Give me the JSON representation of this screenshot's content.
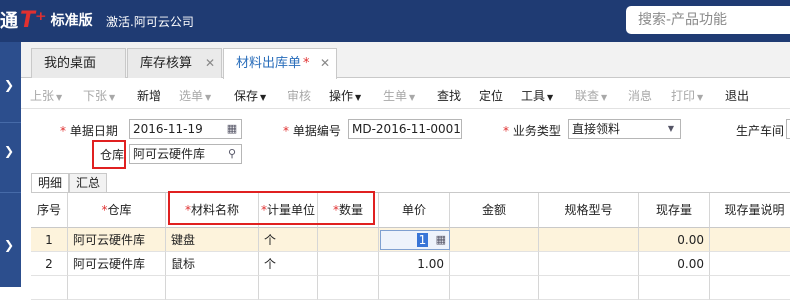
{
  "app": {
    "glyph": "通",
    "brand": "T⁺",
    "edition": "标准版",
    "activation": "激活.阿可云公司",
    "search_placeholder": "搜索-产品功能"
  },
  "tabs": [
    {
      "label": "我的桌面",
      "closable": false,
      "dirty": ""
    },
    {
      "label": "库存核算",
      "closable": true,
      "dirty": ""
    },
    {
      "label": "材料出库单",
      "closable": true,
      "dirty": "*"
    }
  ],
  "toolbar": [
    {
      "label": "上张",
      "dropdown": true,
      "enabled": false
    },
    {
      "label": "下张",
      "dropdown": true,
      "enabled": false
    },
    {
      "label": "新增",
      "dropdown": false,
      "enabled": true
    },
    {
      "label": "选单",
      "dropdown": true,
      "enabled": false
    },
    {
      "label": "保存",
      "dropdown": true,
      "enabled": true
    },
    {
      "label": "审核",
      "dropdown": false,
      "enabled": false
    },
    {
      "label": "操作",
      "dropdown": true,
      "enabled": true
    },
    {
      "label": "生单",
      "dropdown": true,
      "enabled": false
    },
    {
      "label": "查找",
      "dropdown": false,
      "enabled": true
    },
    {
      "label": "定位",
      "dropdown": false,
      "enabled": true
    },
    {
      "label": "工具",
      "dropdown": true,
      "enabled": true
    },
    {
      "label": "联查",
      "dropdown": true,
      "enabled": false
    },
    {
      "label": "消息",
      "dropdown": false,
      "enabled": false
    },
    {
      "label": "打印",
      "dropdown": true,
      "enabled": false
    },
    {
      "label": "退出",
      "dropdown": false,
      "enabled": true
    }
  ],
  "form": {
    "required_mark": "*",
    "date_label": "单据日期",
    "date_value": "2016-11-19",
    "code_label": "单据编号",
    "code_value": "MD-2016-11-0001",
    "biztype_label": "业务类型",
    "biztype_value": "直接领料",
    "workshop_label": "生产车间",
    "warehouse_label": "仓库",
    "warehouse_value": "阿可云硬件库"
  },
  "subtabs": [
    "明细",
    "汇总"
  ],
  "grid": {
    "columns": [
      {
        "label": "序号",
        "required": false
      },
      {
        "label": "仓库",
        "required": true
      },
      {
        "label": "材料名称",
        "required": true
      },
      {
        "label": "计量单位",
        "required": true
      },
      {
        "label": "数量",
        "required": true
      },
      {
        "label": "单价",
        "required": false
      },
      {
        "label": "金额",
        "required": false
      },
      {
        "label": "规格型号",
        "required": false
      },
      {
        "label": "现存量",
        "required": false
      },
      {
        "label": "现存量说明",
        "required": false
      }
    ],
    "rows": [
      {
        "no": "1",
        "warehouse": "阿可云硬件库",
        "material": "键盘",
        "unit": "个",
        "qty": "",
        "price": "1",
        "amount": "",
        "spec": "",
        "stock": "0.00",
        "stock_note": ""
      },
      {
        "no": "2",
        "warehouse": "阿可云硬件库",
        "material": "鼠标",
        "unit": "个",
        "qty": "",
        "price": "1.00",
        "amount": "",
        "spec": "",
        "stock": "0.00",
        "stock_note": ""
      }
    ]
  }
}
